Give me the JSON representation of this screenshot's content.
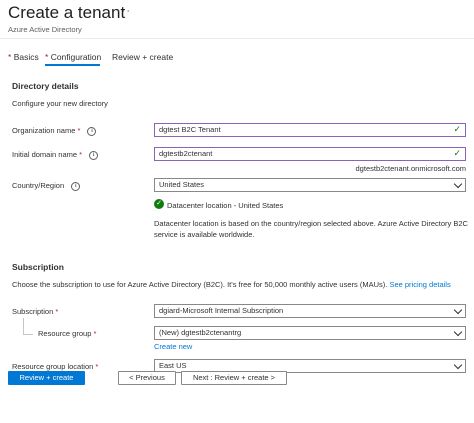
{
  "header": {
    "title": "Create a tenant",
    "more": "···",
    "subtitle": "Azure Active Directory"
  },
  "tabs": [
    {
      "label": "Basics",
      "required": "*"
    },
    {
      "label": "Configuration",
      "required": "*"
    },
    {
      "label": "Review + create"
    }
  ],
  "directory": {
    "heading": "Directory details",
    "description": "Configure your new directory",
    "org_name": {
      "label": "Organization name",
      "required": "*",
      "value": "dgtest B2C Tenant"
    },
    "domain": {
      "label": "Initial domain name",
      "required": "*",
      "value": "dgtestb2ctenant",
      "suffix": "dgtestb2ctenant.onmicrosoft.com"
    },
    "country": {
      "label": "Country/Region",
      "value": "United States"
    },
    "datacenter_status": "Datacenter location - United States",
    "datacenter_note_line1": "Datacenter location is based on the country/region selected above. Azure Active Directory B2C",
    "datacenter_note_line2": "service is available worldwide."
  },
  "subscription": {
    "heading": "Subscription",
    "description": "Choose the subscription to use for Azure Active Directory (B2C). It's free for 50,000 monthly active users (MAUs).",
    "pricing_link": "See pricing details",
    "subscription_field": {
      "label": "Subscription",
      "required": "*",
      "value": "dgiard-Microsoft Internal Subscription"
    },
    "resource_group": {
      "label": "Resource group",
      "required": "*",
      "value": "(New) dgtestb2ctenantrg",
      "create_new": "Create new"
    },
    "location": {
      "label": "Resource group location",
      "required": "*",
      "value": "East US"
    }
  },
  "footer": {
    "review_create": "Review + create",
    "previous": "< Previous",
    "next": "Next : Review + create >"
  },
  "colors": {
    "accent": "#0078d4",
    "success": "#107c10",
    "required": "#a4262c",
    "valid_border": "#8764b8"
  }
}
